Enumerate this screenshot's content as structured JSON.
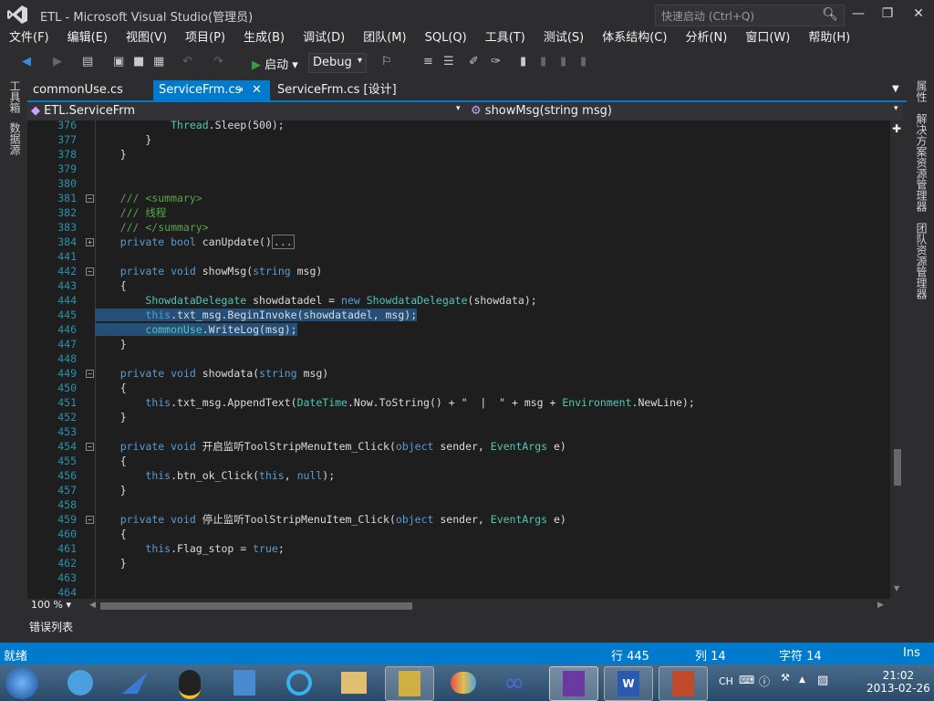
{
  "window": {
    "title": "ETL - Microsoft Visual Studio(管理员)",
    "quick_launch": "快速启动 (Ctrl+Q)"
  },
  "menu": [
    "文件(F)",
    "编辑(E)",
    "视图(V)",
    "项目(P)",
    "生成(B)",
    "调试(D)",
    "团队(M)",
    "SQL(Q)",
    "工具(T)",
    "测试(S)",
    "体系结构(C)",
    "分析(N)",
    "窗口(W)",
    "帮助(H)"
  ],
  "toolbar": {
    "start_label": "启动",
    "config": "Debug"
  },
  "left_panels": [
    "工具箱",
    "数据源"
  ],
  "right_panels": [
    "属性",
    "解决方案资源管理器",
    "团队资源管理器"
  ],
  "tabs": [
    {
      "label": "commonUse.cs"
    },
    {
      "label": "ServiceFrm.cs"
    },
    {
      "label": "ServiceFrm.cs [设计]"
    }
  ],
  "nav": {
    "class": "ETL.ServiceFrm",
    "member": "showMsg(string msg)"
  },
  "code": [
    {
      "n": "376",
      "t": "            Thread.Sleep(500);"
    },
    {
      "n": "377",
      "t": "        }"
    },
    {
      "n": "378",
      "t": "    }"
    },
    {
      "n": "379",
      "t": ""
    },
    {
      "n": "380",
      "t": ""
    },
    {
      "n": "381",
      "t": "    /// <summary>"
    },
    {
      "n": "382",
      "t": "    /// 线程"
    },
    {
      "n": "383",
      "t": "    /// </summary>"
    },
    {
      "n": "384",
      "t": "    private bool canUpdate()..."
    },
    {
      "n": "441",
      "t": ""
    },
    {
      "n": "442",
      "t": "    private void showMsg(string msg)"
    },
    {
      "n": "443",
      "t": "    {"
    },
    {
      "n": "444",
      "t": "        ShowdataDelegate showdatadel = new ShowdataDelegate(showdata);"
    },
    {
      "n": "445",
      "t": "        this.txt_msg.BeginInvoke(showdatadel, msg);"
    },
    {
      "n": "446",
      "t": "        commonUse.WriteLog(msg);"
    },
    {
      "n": "447",
      "t": "    }"
    },
    {
      "n": "448",
      "t": ""
    },
    {
      "n": "449",
      "t": "    private void showdata(string msg)"
    },
    {
      "n": "450",
      "t": "    {"
    },
    {
      "n": "451",
      "t": "        this.txt_msg.AppendText(DateTime.Now.ToString() + \"  |  \" + msg + Environment.NewLine);"
    },
    {
      "n": "452",
      "t": "    }"
    },
    {
      "n": "453",
      "t": ""
    },
    {
      "n": "454",
      "t": "    private void 开启监听ToolStripMenuItem_Click(object sender, EventArgs e)"
    },
    {
      "n": "455",
      "t": "    {"
    },
    {
      "n": "456",
      "t": "        this.btn_ok_Click(this, null);"
    },
    {
      "n": "457",
      "t": "    }"
    },
    {
      "n": "458",
      "t": ""
    },
    {
      "n": "459",
      "t": "    private void 停止监听ToolStripMenuItem_Click(object sender, EventArgs e)"
    },
    {
      "n": "460",
      "t": "    {"
    },
    {
      "n": "461",
      "t": "        this.Flag_stop = true;"
    },
    {
      "n": "462",
      "t": "    }"
    },
    {
      "n": "463",
      "t": ""
    },
    {
      "n": "464",
      "t": ""
    }
  ],
  "zoom": "100 %",
  "error_list": "错误列表",
  "status": {
    "ready": "就绪",
    "line": "行 445",
    "col": "列 14",
    "char": "字符 14",
    "mode": "Ins"
  },
  "tray": {
    "lang": "CH",
    "time": "21:02",
    "date": "2013-02-26"
  }
}
